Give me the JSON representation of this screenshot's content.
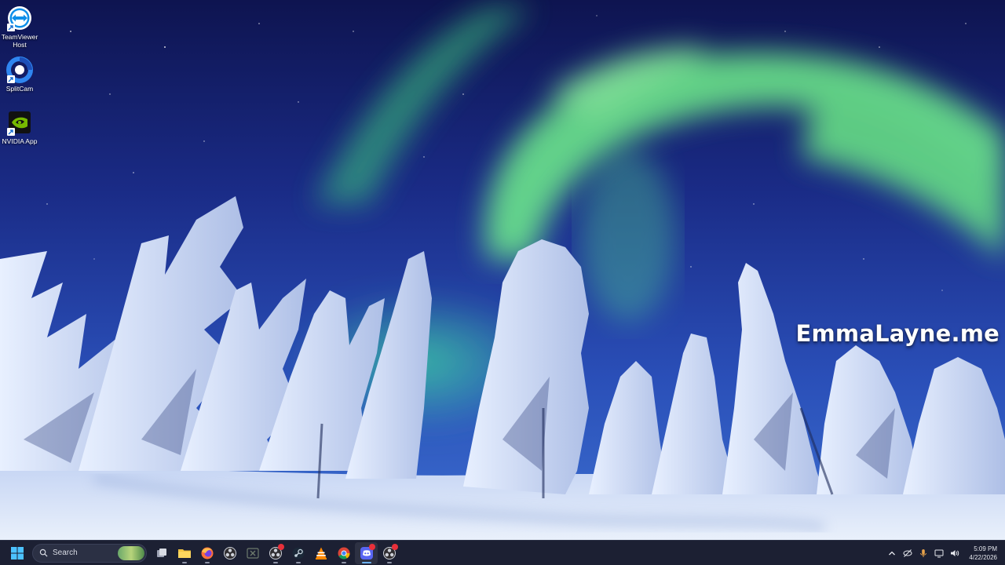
{
  "desktop": {
    "icons": [
      {
        "label": "TeamViewer Host",
        "icon": "teamviewer-icon"
      },
      {
        "label": "SplitCam",
        "icon": "splitcam-icon"
      },
      {
        "label": "NVIDIA App",
        "icon": "nvidia-icon"
      }
    ],
    "watermark": "EmmaLayne.me"
  },
  "taskbar": {
    "search_placeholder": "Search",
    "apps": [
      {
        "name": "Task View",
        "icon": "task-view-icon"
      },
      {
        "name": "File Explorer",
        "icon": "folder-icon"
      },
      {
        "name": "Firefox",
        "icon": "firefox-icon"
      },
      {
        "name": "OBS Studio",
        "icon": "obs-icon"
      },
      {
        "name": "Xbox",
        "icon": "xbox-icon"
      },
      {
        "name": "OBS Studio (notified)",
        "icon": "obs-icon"
      },
      {
        "name": "Steam",
        "icon": "steam-icon"
      },
      {
        "name": "VLC media player",
        "icon": "vlc-icon"
      },
      {
        "name": "Google Chrome",
        "icon": "chrome-icon"
      },
      {
        "name": "Discord",
        "icon": "discord-icon"
      },
      {
        "name": "OBS Studio (recording)",
        "icon": "obs-icon"
      }
    ],
    "clock": {
      "time": "5:09 PM",
      "date": "4/22/2026"
    }
  },
  "colors": {
    "taskbar_bg": "#1c2033",
    "accent": "#6cb2f0",
    "aurora": "#7cf08a",
    "sky": "#1a2a7a"
  }
}
